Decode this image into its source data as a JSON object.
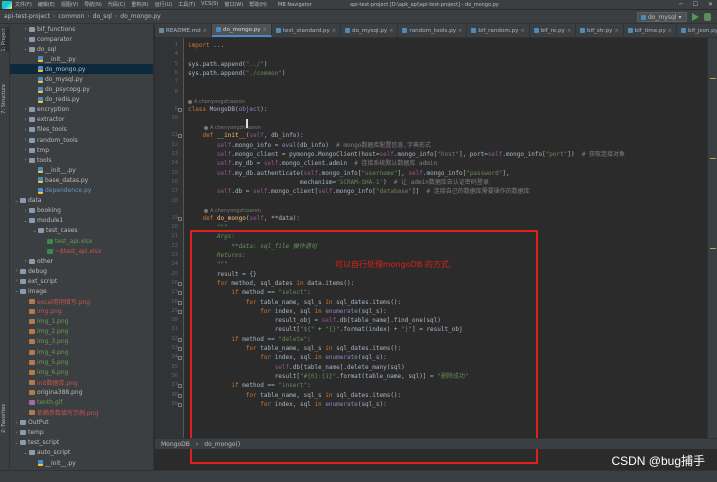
{
  "menu": [
    "文件(F)",
    "编辑(E)",
    "视图(V)",
    "导航(N)",
    "代码(C)",
    "重构(R)",
    "运行(U)",
    "工具(T)",
    "VCS(S)",
    "窗口(W)",
    "帮助(H)"
  ],
  "plugin_menu": "MB Navigator",
  "window_title": "api-test-project [D:\\apk_api\\api-test-project] - do_mongo.py",
  "breadcrumb": [
    "api-test-project",
    "common",
    "do_sql",
    "do_mongo.py"
  ],
  "run_config": "do_mysql",
  "left_tool_tabs": [
    "1: Project",
    "7: Structure",
    "2: Favorites"
  ],
  "tree": [
    {
      "label": "bif_functions",
      "depth": 1,
      "type": "folder",
      "arrow": "›"
    },
    {
      "label": "comparator",
      "depth": 1,
      "type": "folder",
      "arrow": "›"
    },
    {
      "label": "do_sql",
      "depth": 1,
      "type": "folder",
      "arrow": "⌄"
    },
    {
      "label": "__init__.py",
      "depth": 2,
      "type": "py"
    },
    {
      "label": "do_mongo.py",
      "depth": 2,
      "type": "py",
      "selected": true
    },
    {
      "label": "do_mysql.py",
      "depth": 2,
      "type": "py"
    },
    {
      "label": "do_psycopg.py",
      "depth": 2,
      "type": "py"
    },
    {
      "label": "do_redis.py",
      "depth": 2,
      "type": "py"
    },
    {
      "label": "encryption",
      "depth": 1,
      "type": "folder",
      "arrow": "›"
    },
    {
      "label": "extractor",
      "depth": 1,
      "type": "folder",
      "arrow": "›"
    },
    {
      "label": "files_tools",
      "depth": 1,
      "type": "folder",
      "arrow": "›"
    },
    {
      "label": "random_tools",
      "depth": 1,
      "type": "folder",
      "arrow": "›"
    },
    {
      "label": "tmp",
      "depth": 1,
      "type": "folder",
      "arrow": "›"
    },
    {
      "label": "tools",
      "depth": 1,
      "type": "folder",
      "arrow": "›"
    },
    {
      "label": "__init__.py",
      "depth": 2,
      "type": "py"
    },
    {
      "label": "base_datas.py",
      "depth": 2,
      "type": "py"
    },
    {
      "label": "dependence.py",
      "depth": 2,
      "type": "py",
      "color": "blue"
    },
    {
      "label": "data",
      "depth": 0,
      "type": "folder",
      "arrow": "⌄"
    },
    {
      "label": "booking",
      "depth": 1,
      "type": "folder",
      "arrow": "›"
    },
    {
      "label": "module1",
      "depth": 1,
      "type": "folder",
      "arrow": "⌄"
    },
    {
      "label": "test_cases",
      "depth": 2,
      "type": "folder",
      "arrow": "⌄"
    },
    {
      "label": "test_api.xlsx",
      "depth": 3,
      "type": "xlsx",
      "color": "green"
    },
    {
      "label": "~$test_api.xlsx",
      "depth": 3,
      "type": "xlsx",
      "color": "red"
    },
    {
      "label": "other",
      "depth": 1,
      "type": "folder",
      "arrow": "›"
    },
    {
      "label": "debug",
      "depth": 0,
      "type": "folder",
      "arrow": "›"
    },
    {
      "label": "ext_script",
      "depth": 0,
      "type": "folder",
      "arrow": "›"
    },
    {
      "label": "image",
      "depth": 0,
      "type": "folder",
      "arrow": "⌄"
    },
    {
      "label": "excel用例填写.png",
      "depth": 1,
      "type": "png",
      "color": "red"
    },
    {
      "label": "img.png",
      "depth": 1,
      "type": "png",
      "color": "red"
    },
    {
      "label": "img_1.png",
      "depth": 1,
      "type": "png",
      "color": "green"
    },
    {
      "label": "img_2.png",
      "depth": 1,
      "type": "png",
      "color": "green"
    },
    {
      "label": "img_3.png",
      "depth": 1,
      "type": "png",
      "color": "green"
    },
    {
      "label": "img_4.png",
      "depth": 1,
      "type": "png",
      "color": "green"
    },
    {
      "label": "img_5.png",
      "depth": 1,
      "type": "png",
      "color": "green"
    },
    {
      "label": "img_6.png",
      "depth": 1,
      "type": "png",
      "color": "green"
    },
    {
      "label": "init数据库.png",
      "depth": 1,
      "type": "png",
      "color": "red"
    },
    {
      "label": "origina388.png",
      "depth": 1,
      "type": "png"
    },
    {
      "label": "tenth.gif",
      "depth": 1,
      "type": "gif",
      "color": "green"
    },
    {
      "label": "依赖参数填写示例.png",
      "depth": 1,
      "type": "png",
      "color": "red"
    },
    {
      "label": "OutPut",
      "depth": 0,
      "type": "folder",
      "arrow": "›"
    },
    {
      "label": "temp",
      "depth": 0,
      "type": "folder",
      "arrow": "›"
    },
    {
      "label": "test_script",
      "depth": 0,
      "type": "folder",
      "arrow": "⌄"
    },
    {
      "label": "auto_script",
      "depth": 1,
      "type": "folder",
      "arrow": "⌄"
    },
    {
      "label": "__init__.py",
      "depth": 2,
      "type": "py"
    }
  ],
  "tabs": [
    {
      "label": "README.md",
      "icon": "md"
    },
    {
      "label": "do_mongo.py",
      "icon": "py",
      "active": true
    },
    {
      "label": "test_standard.py",
      "icon": "py"
    },
    {
      "label": "do_mysql.py",
      "icon": "py"
    },
    {
      "label": "random_tools.py",
      "icon": "py"
    },
    {
      "label": "bif_random.py",
      "icon": "py"
    },
    {
      "label": "bif_re.py",
      "icon": "py"
    },
    {
      "label": "bif_str.py",
      "icon": "py"
    },
    {
      "label": "bif_time.py",
      "icon": "py"
    },
    {
      "label": "bif_json.py",
      "icon": "py"
    }
  ],
  "lines": [
    {
      "n": "1",
      "html": "<span class='kw'>import</span> ..."
    },
    {
      "n": "4",
      "html": ""
    },
    {
      "n": "5",
      "html": "sys.path.append(<span class='st'>\"../\"</span>)"
    },
    {
      "n": "6",
      "html": "sys.path.append(<span class='st'>\"./common\"</span>)"
    },
    {
      "n": "7",
      "html": ""
    },
    {
      "n": "8",
      "html": ""
    },
    {
      "hint": "A chenyongzhiaaron"
    },
    {
      "n": "9",
      "html": "<span class='kw'>class</span> MongoDB(<span class='bi'>object</span>):"
    },
    {
      "n": "10",
      "html": ""
    },
    {
      "hint": "A chenyongzhiaaron",
      "indent": 1
    },
    {
      "n": "11",
      "html": "    <span class='kw'>def</span> <span class='fn'>__init__</span>(<span class='sf'>self</span>, db_info):"
    },
    {
      "n": "12",
      "html": "        <span class='sf'>self</span>.mongo_info = <span class='bi'>eval</span>(db_info)  <span class='cm'># mongo数据库配置信息,字典形式</span>"
    },
    {
      "n": "13",
      "html": "        <span class='sf'>self</span>.mongo_client = pymongo.MongoClient(host=<span class='sf'>self</span>.mongo_info[<span class='st'>\"host\"</span>], port=<span class='sf'>self</span>.mongo_info[<span class='st'>\"port\"</span>])  <span class='cm'># 获取连接对象</span>"
    },
    {
      "n": "14",
      "html": "        <span class='sf'>self</span>.my_db = <span class='sf'>self</span>.mongo_client.admin  <span class='cm'># 连接系统默认数据库 admin</span>"
    },
    {
      "n": "15",
      "html": "        <span class='sf'>self</span>.my_db.authenticate(<span class='sf'>self</span>.mongo_info[<span class='st'>\"username\"</span>], <span class='sf'>self</span>.mongo_info[<span class='st'>\"password\"</span>],"
    },
    {
      "n": "16",
      "html": "                               mechanism=<span class='st'>'SCRAM-SHA-1'</span>)  <span class='cm'># 让 admin数据库去认证密码登录</span>"
    },
    {
      "n": "17",
      "html": "        <span class='sf'>self</span>.db = <span class='sf'>self</span>.mongo_client[<span class='sf'>self</span>.mongo_info[<span class='st'>\"database\"</span>]]  <span class='cm'># 连接自己的数据库需要操作的数据库</span>"
    },
    {
      "n": "18",
      "html": ""
    },
    {
      "hint": "A chenyongzhiaaron",
      "indent": 1
    },
    {
      "n": "19",
      "html": "    <span class='kw'>def</span> <span class='fn'>do_mongo</span>(<span class='sf'>self</span>, **data):"
    },
    {
      "n": "20",
      "html": "        <span class='dc'>\"\"\"</span>"
    },
    {
      "n": "21",
      "html": "<span class='dc'>        Args:</span>"
    },
    {
      "n": "22",
      "html": "<span class='dc'>            **data: sql_file 操作语句</span>"
    },
    {
      "n": "23",
      "html": "<span class='dc'>        Returns:</span>"
    },
    {
      "n": "24",
      "html": "<span class='dc'>        \"\"\"</span>"
    },
    {
      "n": "25",
      "html": "        result = {}"
    },
    {
      "n": "26",
      "html": "        <span class='kw'>for</span> method, sql_dates <span class='kw'>in</span> data.items():"
    },
    {
      "n": "27",
      "html": "            <span class='kw'>if</span> method == <span class='st'>\"select\"</span>:"
    },
    {
      "n": "28",
      "html": "                <span class='kw'>for</span> table_name, sql_s <span class='kw'>in</span> sql_dates.items():"
    },
    {
      "n": "29",
      "html": "                    <span class='kw'>for</span> index, sql <span class='kw'>in</span> <span class='bi'>enumerate</span>(sql_s):"
    },
    {
      "n": "30",
      "html": "                        result_obj = <span class='sf'>self</span>.db[table_name].find_one(sql)"
    },
    {
      "n": "31",
      "html": "                        result[<span class='st'>\"${\"</span> + <span class='st'>\"{}\"</span>.format(index) + <span class='st'>\"}\"</span>] = result_obj"
    },
    {
      "n": "32",
      "html": "            <span class='kw'>if</span> method == <span class='st'>\"delete\"</span>:"
    },
    {
      "n": "33",
      "html": "                <span class='kw'>for</span> table_name, sql_s <span class='kw'>in</span> sql_dates.items():"
    },
    {
      "n": "34",
      "html": "                    <span class='kw'>for</span> index, sql <span class='kw'>in</span> <span class='bi'>enumerate</span>(sql_s):"
    },
    {
      "n": "35",
      "html": "                        <span class='sf'>self</span>.db[table_name].delete_many(sql)"
    },
    {
      "n": "36",
      "html": "                        result[<span class='st'>\"#{0}:{1}\"</span>.format(table_name, sql)] = <span class='st'>\"删除成功\"</span>"
    },
    {
      "n": "37",
      "html": "            <span class='kw'>if</span> method == <span class='st'>\"insert\"</span>:"
    },
    {
      "n": "38",
      "html": "                <span class='kw'>for</span> table_name, sql_s <span class='kw'>in</span> sql_dates.items():"
    },
    {
      "n": "39",
      "html": "                    <span class='kw'>for</span> index, sql <span class='kw'>in</span> <span class='bi'>enumerate</span>(sql_s):"
    }
  ],
  "annotation": {
    "text": "可以自行处理mongoDB 的方式,",
    "color": "#e0201a"
  },
  "code_breadcrumb": [
    "MongoDB",
    "do_mongo()"
  ],
  "watermark": "CSDN @bug捕手",
  "colors": {
    "accent": "#4a88c7",
    "background": "#2b2b2b",
    "panel": "#3c3f41",
    "annotation": "#e0201a"
  }
}
